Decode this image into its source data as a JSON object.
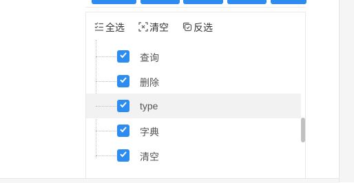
{
  "toolbar": {
    "select_all": "全选",
    "clear": "清空",
    "invert": "反选"
  },
  "tree_items": [
    {
      "label": "查询",
      "checked": true
    },
    {
      "label": "删除",
      "checked": true
    },
    {
      "label": "type",
      "checked": true,
      "highlighted": true
    },
    {
      "label": "字典",
      "checked": true
    },
    {
      "label": "清空",
      "checked": true
    }
  ],
  "colors": {
    "accent": "#2d8cf0",
    "highlight": "#f2f2f2"
  },
  "icons": {
    "select_all": "list-check-icon",
    "clear": "clear-selection-icon",
    "invert": "invert-copy-icon",
    "checkbox": "checkmark-icon"
  }
}
